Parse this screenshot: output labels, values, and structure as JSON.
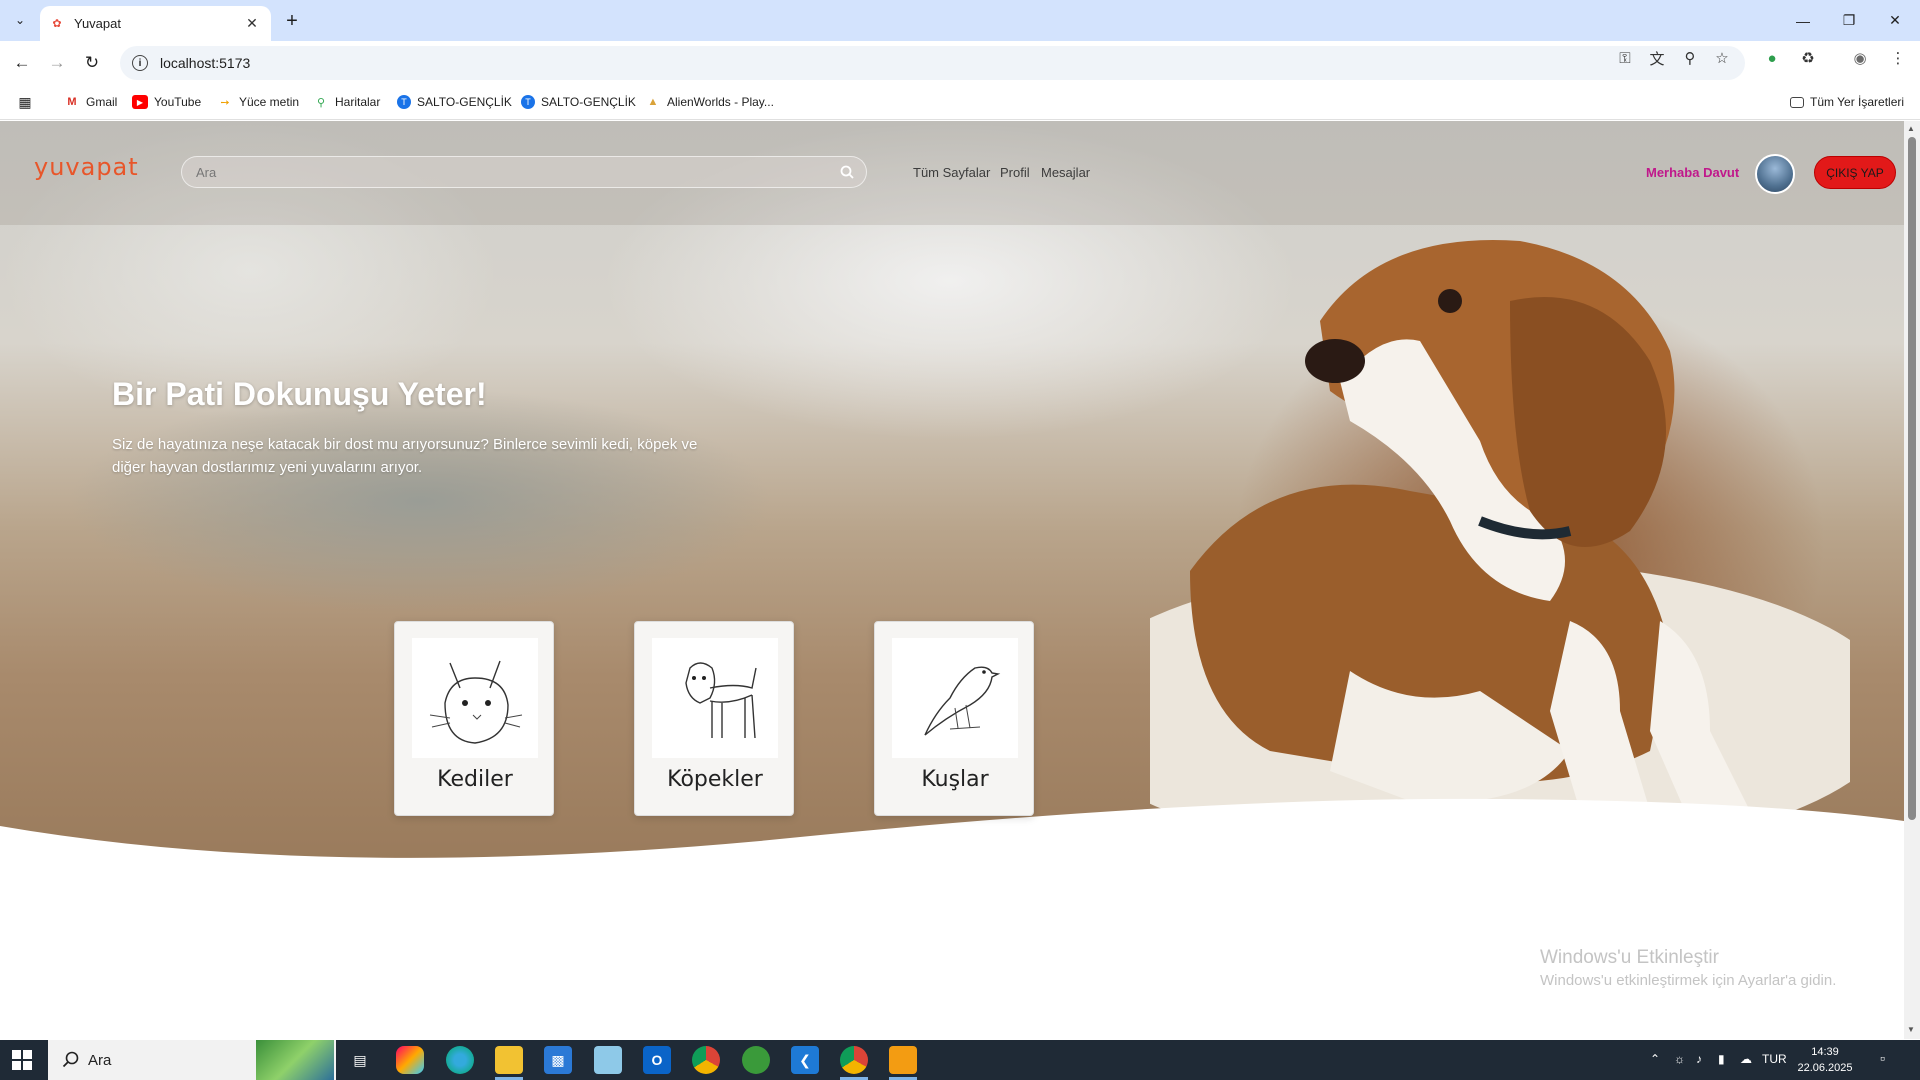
{
  "browser": {
    "tab_title": "Yuvapat",
    "url": "localhost:5173",
    "bookmarks": [
      "Gmail",
      "YouTube",
      "Yüce metin",
      "Haritalar",
      "SALTO-GENÇLİK",
      "SALTO-GENÇLİK",
      "AlienWorlds - Play..."
    ],
    "all_bookmarks": "Tüm Yer İşaretleri"
  },
  "site": {
    "logo": "yuvapat",
    "search_placeholder": "Ara",
    "nav": [
      "Tüm Sayfalar",
      "Profil",
      "Mesajlar"
    ],
    "greeting": "Merhaba Davut",
    "logout": "ÇIKIŞ YAP"
  },
  "hero": {
    "title": "Bir Pati Dokunuşu Yeter!",
    "text": "Siz de hayatınıza neşe katacak bir dost mu arıyorsunuz? Binlerce sevimli kedi, köpek ve diğer hayvan dostlarımız yeni yuvalarını arıyor."
  },
  "categories": [
    "Kediler",
    "Köpekler",
    "Kuşlar"
  ],
  "watermark": {
    "title": "Windows'u Etkinleştir",
    "subtitle": "Windows'u etkinleştirmek için Ayarlar'a gidin."
  },
  "taskbar": {
    "search_placeholder": "Ara",
    "language": "TUR",
    "time": "14:39",
    "date": "22.06.2025"
  },
  "colors": {
    "accent_logo": "#e8562a",
    "greeting": "#c0188b",
    "logout_bg": "#e21919"
  }
}
